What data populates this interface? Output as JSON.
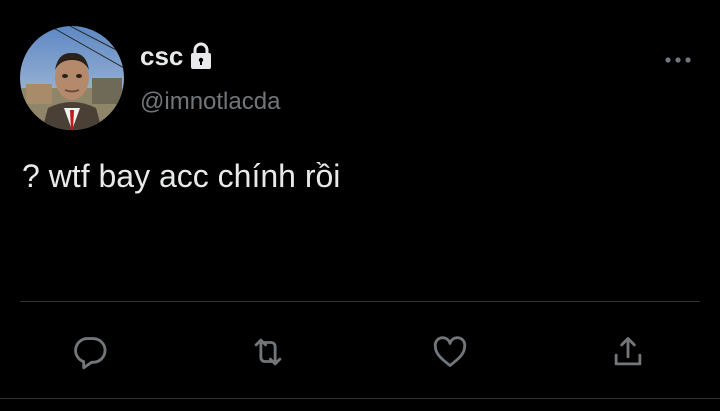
{
  "author": {
    "display_name": "csc",
    "handle": "@imnotlacda",
    "protected": true
  },
  "tweet": {
    "text": "? wtf bay acc chính rồi"
  },
  "actions": {
    "reply_icon": "reply-icon",
    "retweet_icon": "retweet-icon",
    "like_icon": "heart-icon",
    "share_icon": "share-icon"
  },
  "colors": {
    "background": "#000000",
    "primary_text": "#e7e9ea",
    "secondary_text": "#71767b",
    "divider": "#2f3336"
  }
}
